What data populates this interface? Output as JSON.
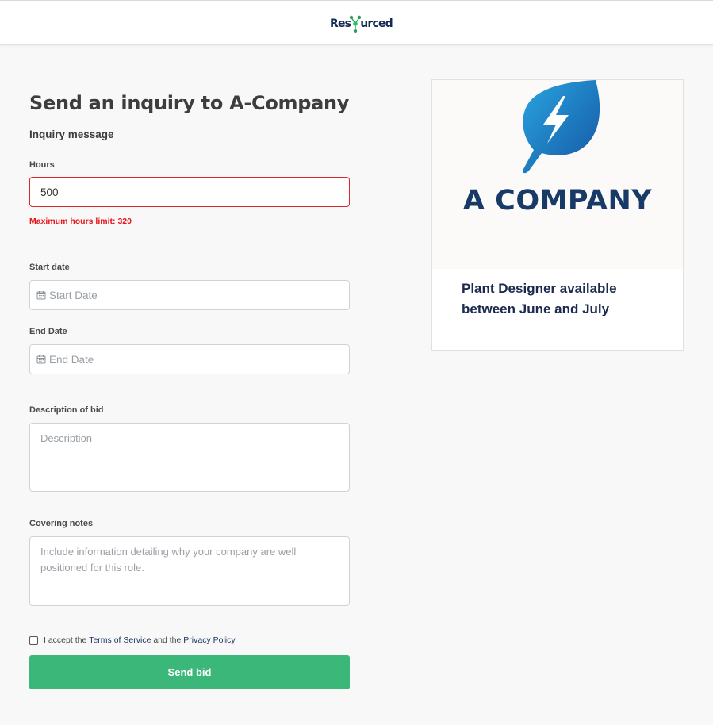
{
  "header": {
    "logo_text_left": "Res",
    "logo_text_right": "urced"
  },
  "page": {
    "title": "Send an inquiry to A-Company",
    "subtitle": "Inquiry message"
  },
  "form": {
    "hours": {
      "label": "Hours",
      "value": "500",
      "error_prefix": "Maximum hours limit:",
      "error_value": "320"
    },
    "start_date": {
      "label": "Start date",
      "placeholder": "Start Date"
    },
    "end_date": {
      "label": "End Date",
      "placeholder": "End Date"
    },
    "description": {
      "label": "Description of bid",
      "placeholder": "Description"
    },
    "covering_notes": {
      "label": "Covering notes",
      "placeholder": "Include information detailing why your company are well positioned for this role."
    },
    "terms": {
      "prefix": "I accept the",
      "terms_link": "Terms of Service",
      "middle": "and the",
      "privacy_link": "Privacy Policy",
      "checked": false
    },
    "submit_label": "Send bid"
  },
  "card": {
    "company_name": "A COMPANY",
    "description": "Plant Designer available between June and July"
  },
  "colors": {
    "accent_green": "#3bb77a",
    "error_red": "#e8141b",
    "navy": "#173b66",
    "leaf_blue": "#1a7bc4"
  },
  "icons": [
    "logo-node-icon",
    "calendar-icon",
    "leaf-bolt-icon"
  ]
}
